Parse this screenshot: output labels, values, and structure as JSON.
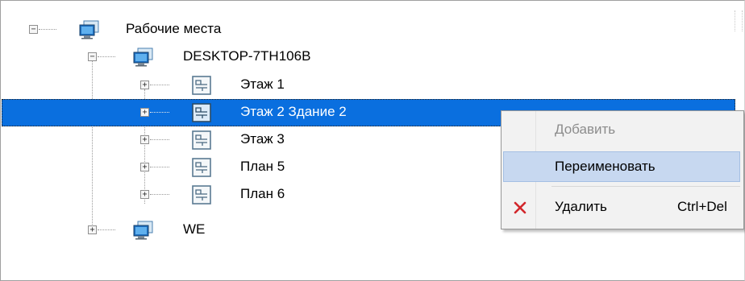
{
  "tree": {
    "root": {
      "label": "Рабочие места",
      "expander": "−"
    },
    "desktop": {
      "label": "DESKTOP-7TH106B",
      "expander": "−"
    },
    "children": [
      {
        "label": "Этаж 1",
        "expander": "+"
      },
      {
        "label": "Этаж 2 Здание 2",
        "expander": "+"
      },
      {
        "label": "Этаж 3",
        "expander": "+"
      },
      {
        "label": "План 5",
        "expander": "+"
      },
      {
        "label": "План 6",
        "expander": "+"
      }
    ],
    "we": {
      "label": "WE",
      "expander": "+"
    }
  },
  "context_menu": {
    "add_label": "Добавить",
    "rename_label": "Переименовать",
    "delete_label": "Удалить",
    "delete_shortcut": "Ctrl+Del"
  },
  "colors": {
    "selection": "#0a6fdf",
    "menu_hover": "#c7d8f0",
    "delete_icon": "#d2272c"
  }
}
